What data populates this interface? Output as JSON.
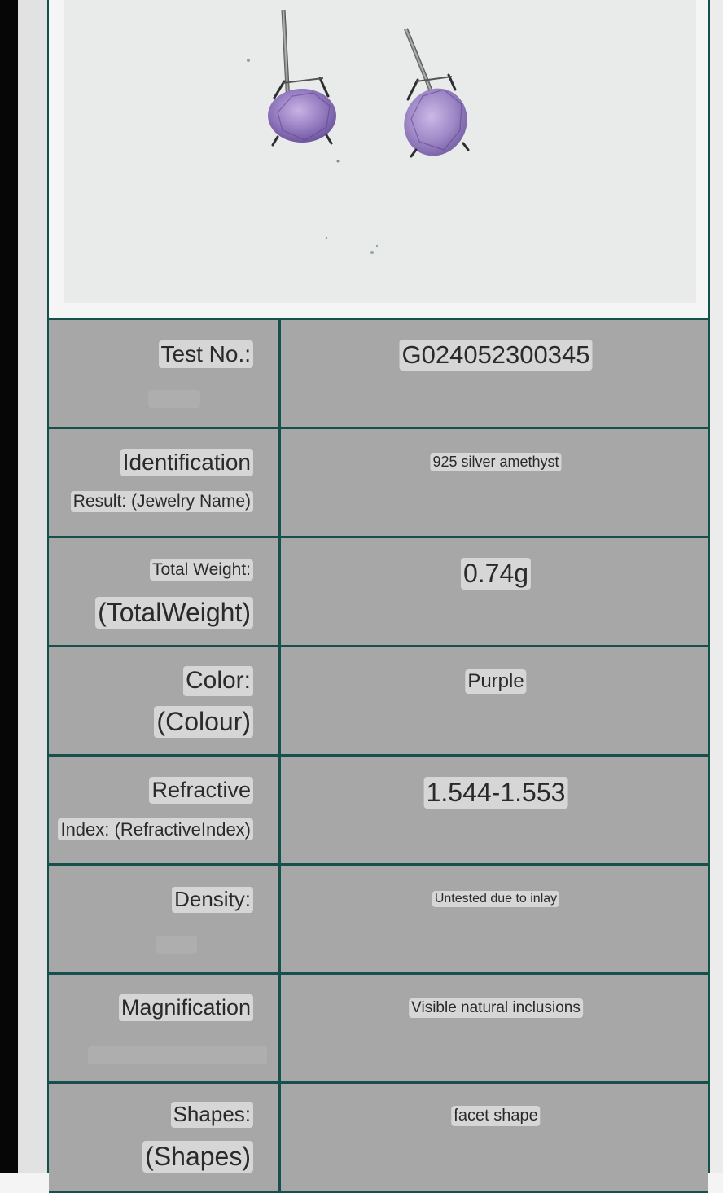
{
  "photo": {
    "subject_icon": "amethyst-stud-earrings-photo",
    "stone_color": "#8e76b8"
  },
  "colors": {
    "border": "#16504c",
    "cell_background": "#a7a7a7",
    "label_tag_background": "#d6d6d6"
  },
  "rows": [
    {
      "label_line1": "Test No.:",
      "label_line2": "",
      "value": "G024052300345"
    },
    {
      "label_line1": "Identification",
      "label_line2": "Result: (Jewelry Name)",
      "value": "925 silver amethyst"
    },
    {
      "label_line1": "Total Weight:",
      "label_line2": "(TotalWeight)",
      "value": "0.74g"
    },
    {
      "label_line1": "Color:",
      "label_line2": "(Colour)",
      "value": "Purple"
    },
    {
      "label_line1": "Refractive",
      "label_line2": "Index: (RefractiveIndex)",
      "value": "1.544-1.553"
    },
    {
      "label_line1": "Density:",
      "label_line2": "",
      "value": "Untested due to inlay"
    },
    {
      "label_line1": "Magnification",
      "label_line2": "",
      "value": "Visible natural inclusions"
    },
    {
      "label_line1": "Shapes:",
      "label_line2": "(Shapes)",
      "value": "facet shape"
    }
  ]
}
